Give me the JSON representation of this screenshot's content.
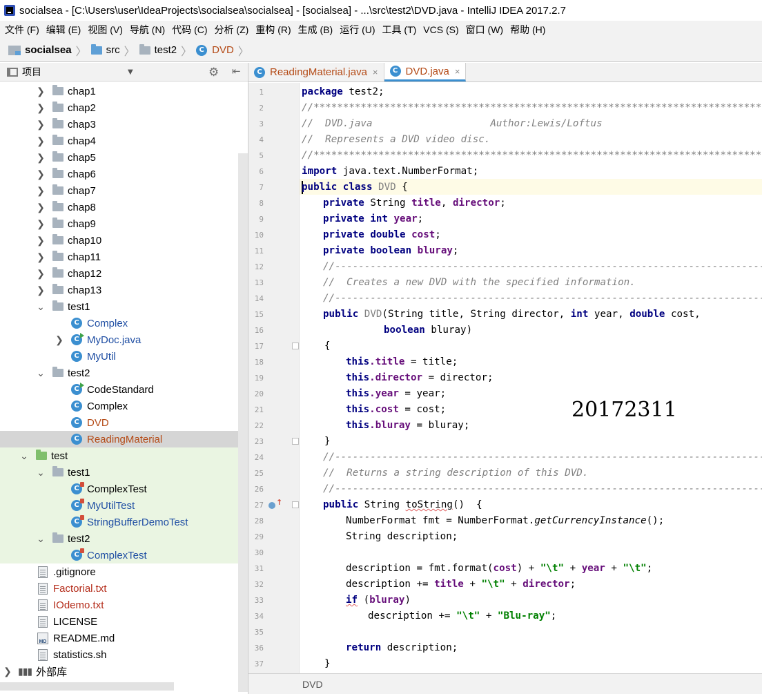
{
  "window": {
    "title": "socialsea - [C:\\Users\\user\\IdeaProjects\\socialsea\\socialsea] - [socialsea] - ...\\src\\test2\\DVD.java - IntelliJ IDEA 2017.2.7"
  },
  "menubar": {
    "items": [
      "文件 (F)",
      "编辑 (E)",
      "视图 (V)",
      "导航 (N)",
      "代码 (C)",
      "分析 (Z)",
      "重构 (R)",
      "生成 (B)",
      "运行 (U)",
      "工具 (T)",
      "VCS (S)",
      "窗口 (W)",
      "帮助 (H)"
    ]
  },
  "breadcrumb": {
    "project": "socialsea",
    "src": "src",
    "package": "test2",
    "file": "DVD"
  },
  "project_panel": {
    "label": "项目",
    "tree": [
      {
        "label": "chap1",
        "kind": "folder"
      },
      {
        "label": "chap2",
        "kind": "folder"
      },
      {
        "label": "chap3",
        "kind": "folder"
      },
      {
        "label": "chap4",
        "kind": "folder"
      },
      {
        "label": "chap5",
        "kind": "folder"
      },
      {
        "label": "chap6",
        "kind": "folder"
      },
      {
        "label": "chap7",
        "kind": "folder"
      },
      {
        "label": "chap8",
        "kind": "folder"
      },
      {
        "label": "chap9",
        "kind": "folder"
      },
      {
        "label": "chap10",
        "kind": "folder"
      },
      {
        "label": "chap11",
        "kind": "folder"
      },
      {
        "label": "chap12",
        "kind": "folder"
      },
      {
        "label": "chap13",
        "kind": "folder"
      },
      {
        "label": "test1",
        "kind": "folder"
      },
      {
        "label": "Complex",
        "kind": "class"
      },
      {
        "label": "MyDoc.java",
        "kind": "class"
      },
      {
        "label": "MyUtil",
        "kind": "class"
      },
      {
        "label": "test2",
        "kind": "folder"
      },
      {
        "label": "CodeStandard",
        "kind": "class"
      },
      {
        "label": "Complex",
        "kind": "class"
      },
      {
        "label": "DVD",
        "kind": "class"
      },
      {
        "label": "ReadingMaterial",
        "kind": "class"
      },
      {
        "label": "test",
        "kind": "folder"
      },
      {
        "label": "test1",
        "kind": "folder"
      },
      {
        "label": "ComplexTest",
        "kind": "class"
      },
      {
        "label": "MyUtilTest",
        "kind": "class"
      },
      {
        "label": "StringBufferDemoTest",
        "kind": "class"
      },
      {
        "label": "test2",
        "kind": "folder"
      },
      {
        "label": "ComplexTest",
        "kind": "class"
      },
      {
        "label": ".gitignore",
        "kind": "file"
      },
      {
        "label": "Factorial.txt",
        "kind": "file"
      },
      {
        "label": "IOdemo.txt",
        "kind": "file"
      },
      {
        "label": "LICENSE",
        "kind": "file"
      },
      {
        "label": "README.md",
        "kind": "file"
      },
      {
        "label": "statistics.sh",
        "kind": "file"
      },
      {
        "label": "外部库",
        "kind": "library"
      }
    ],
    "class_icon_letter": "C",
    "md_badge": "MD"
  },
  "tabs": [
    {
      "label": "ReadingMaterial.java"
    },
    {
      "label": "DVD.java"
    }
  ],
  "tab_close": "×",
  "editor": {
    "line_numbers": [
      "1",
      "2",
      "3",
      "4",
      "5",
      "6",
      "7",
      "8",
      "9",
      "10",
      "11",
      "12",
      "13",
      "14",
      "15",
      "16",
      "17",
      "18",
      "19",
      "20",
      "21",
      "22",
      "23",
      "24",
      "25",
      "26",
      "27",
      "28",
      "29",
      "30",
      "31",
      "32",
      "33",
      "34",
      "35",
      "36",
      "37"
    ],
    "code": {
      "l1_kw": "package",
      "l1_rest": " test2;",
      "l2": "//************************************************************************************",
      "l3": "//  DVD.java                    Author:Lewis/Loftus",
      "l4": "//  Represents a DVD video disc.",
      "l5": "//************************************************************************************",
      "l6_kw": "import",
      "l6_rest": " java.text.NumberFormat;",
      "l7_kw": "public class",
      "l7_name": " DVD",
      "l7_rest": " {",
      "l8_kw": "private",
      "l8_type": " String ",
      "l8_f1": "title",
      "l8_sep": ", ",
      "l8_f2": "director",
      "l8_end": ";",
      "l9_kw": "private int ",
      "l9_f": "year",
      "l9_end": ";",
      "l10_kw": "private double ",
      "l10_f": "cost",
      "l10_end": ";",
      "l11_kw": "private boolean ",
      "l11_f": "bluray",
      "l11_end": ";",
      "l12": "//------------------------------------------------------------------------------------",
      "l13": "//  Creates a new DVD with the specified information.",
      "l14": "//------------------------------------------------------------------------------------",
      "l15_kw": "public",
      "l15_name": " DVD",
      "l15_a": "(String title, String director, ",
      "l15_kw2": "int",
      "l15_b": " year, ",
      "l15_kw3": "double",
      "l15_c": " cost,",
      "l16_kw": "boolean",
      "l16_rest": " bluray)",
      "l17": "{",
      "l18_kw": "this",
      "l18_f": ".title",
      "l18_rest": " = title;",
      "l19_kw": "this",
      "l19_f": ".director",
      "l19_rest": " = director;",
      "l20_kw": "this",
      "l20_f": ".year",
      "l20_rest": " = year;",
      "l21_kw": "this",
      "l21_f": ".cost",
      "l21_rest": " = cost;",
      "l22_kw": "this",
      "l22_f": ".bluray",
      "l22_rest": " = bluray;",
      "l23": "}",
      "l24": "//------------------------------------------------------------------------------------",
      "l25": "//  Returns a string description of this DVD.",
      "l26": "//------------------------------------------------------------------------------------",
      "l27_kw": "public",
      "l27_a": " String ",
      "l27_m": "toString",
      "l27_rest": "()  {",
      "l28_a": "NumberFormat fmt = NumberFormat.",
      "l28_m": "getCurrencyInstance",
      "l28_rest": "();",
      "l29": "String description;",
      "l31_a": "description = fmt.format(",
      "l31_f1": "cost",
      "l31_b": ") + ",
      "l31_s1": "\"\\t\"",
      "l31_c": " + ",
      "l31_f2": "year",
      "l31_d": " + ",
      "l31_s2": "\"\\t\"",
      "l31_e": ";",
      "l32_a": "description += ",
      "l32_f1": "title",
      "l32_b": " + ",
      "l32_s1": "\"\\t\"",
      "l32_c": " + ",
      "l32_f2": "director",
      "l32_d": ";",
      "l33_kw": "if",
      "l33_a": " (",
      "l33_f": "bluray",
      "l33_b": ")",
      "l34_a": "description += ",
      "l34_s1": "\"\\t\"",
      "l34_b": " + ",
      "l34_s2": "\"Blu-ray\"",
      "l34_c": ";",
      "l36_kw": "return",
      "l36_rest": " description;",
      "l37": "}"
    }
  },
  "watermark": "20172311",
  "statusbar": {
    "breadcrumb": "DVD"
  },
  "colors": {
    "keyword": "#000080",
    "field": "#660e7a",
    "comment": "#808080",
    "string": "#008000",
    "class_icon": "#3b8fd0",
    "test_bg": "#eaf5e2",
    "current_line": "#fefbe6"
  }
}
